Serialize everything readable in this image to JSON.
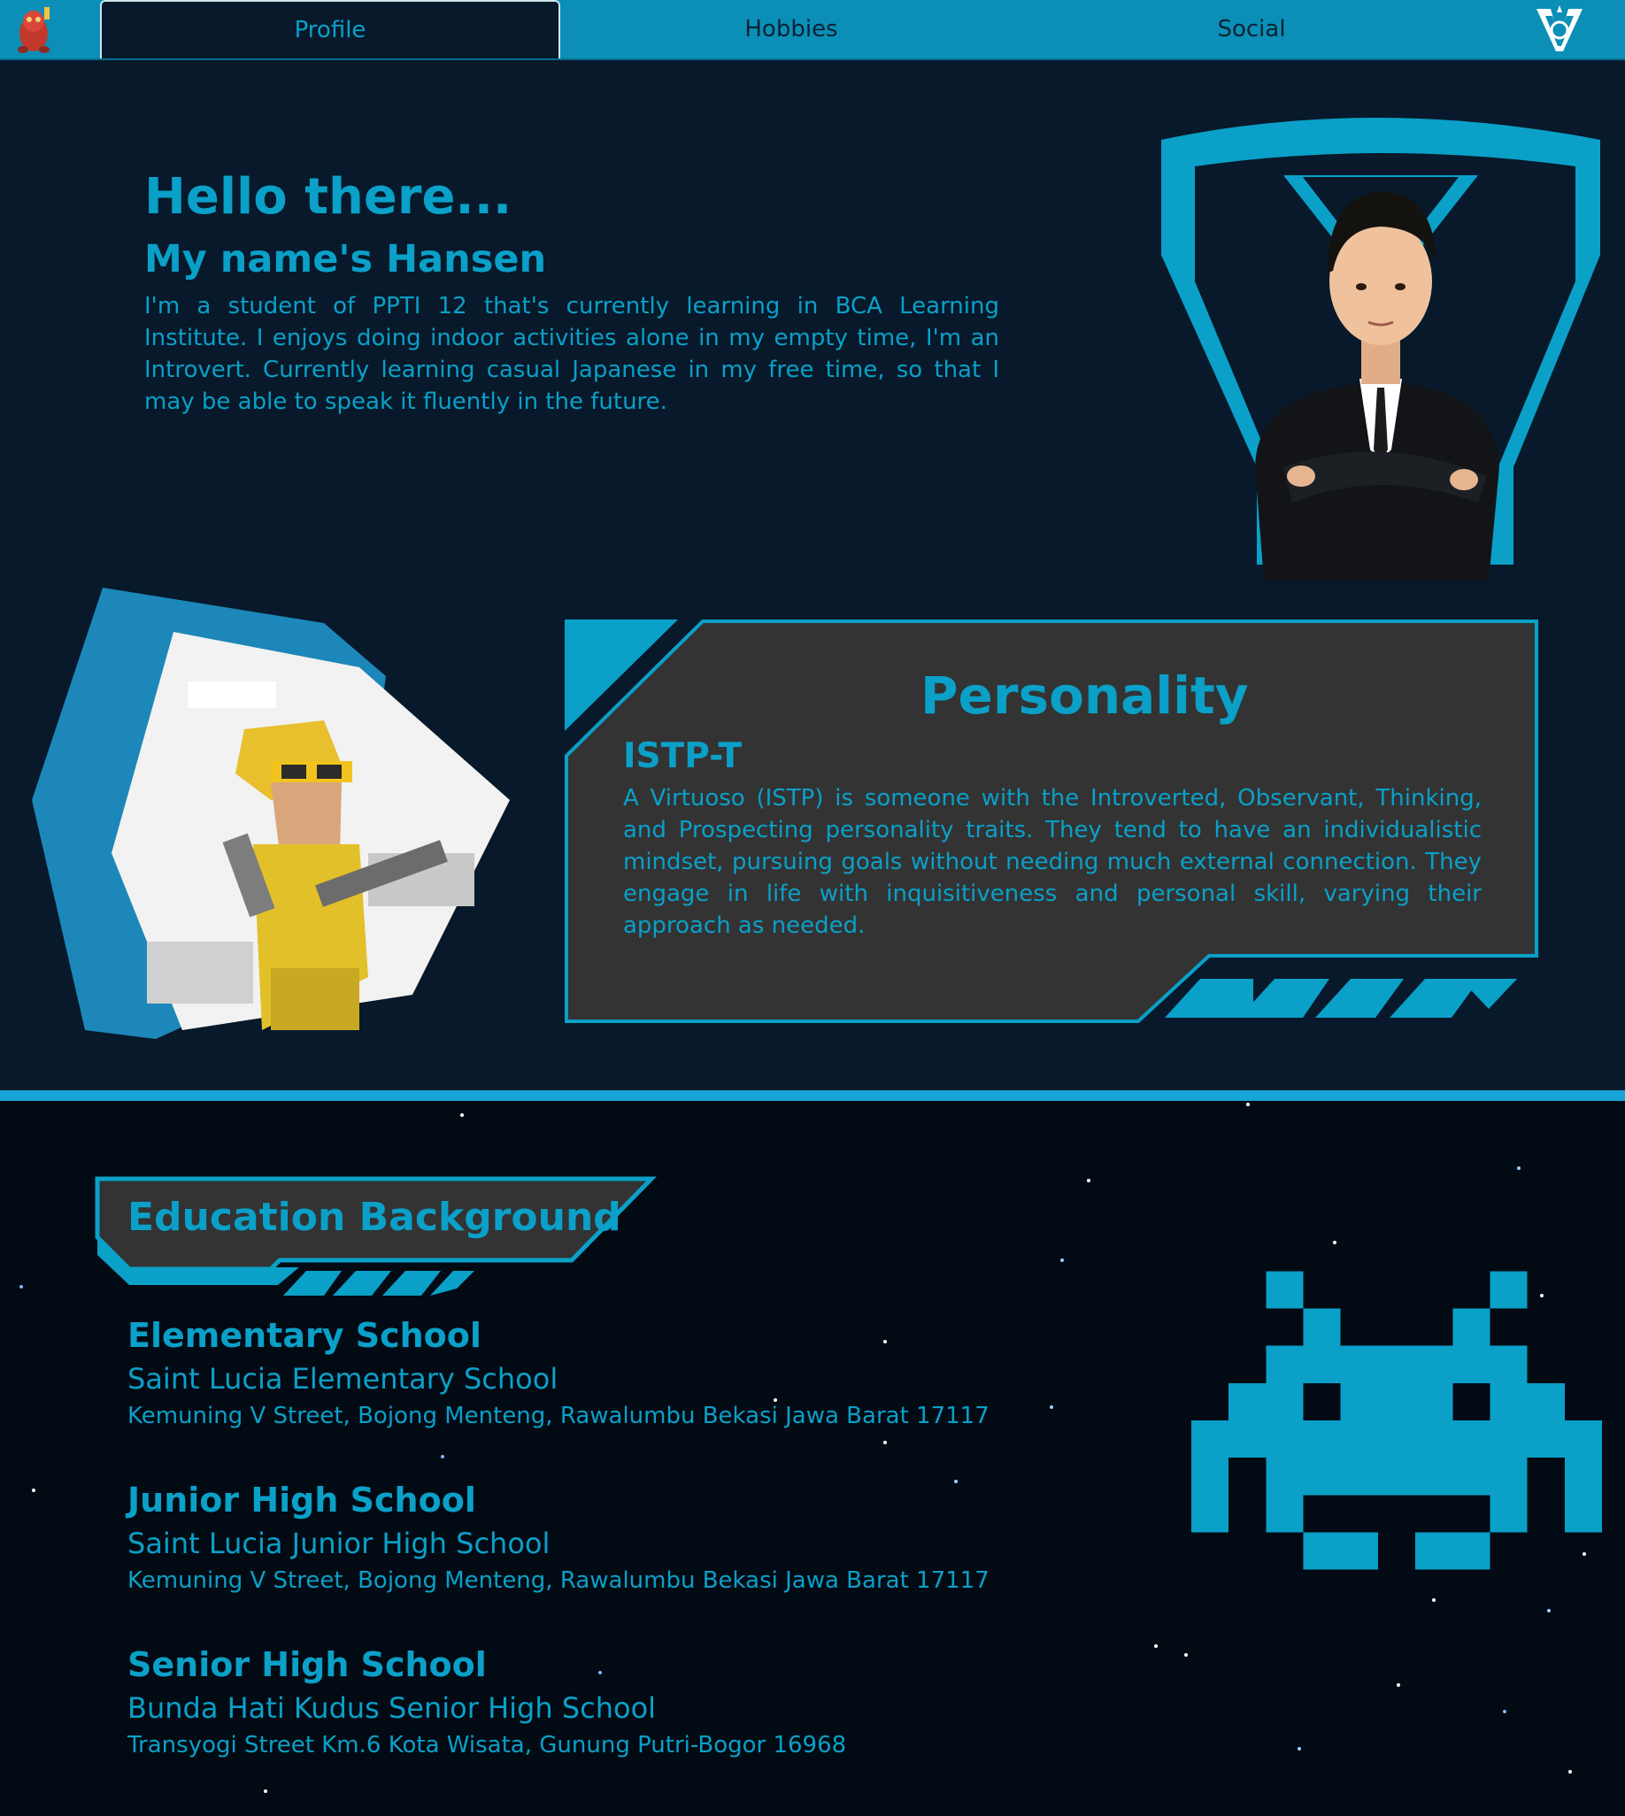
{
  "nav": {
    "tabs": [
      {
        "label": "Profile",
        "active": true
      },
      {
        "label": "Hobbies",
        "active": false
      },
      {
        "label": "Social",
        "active": false
      }
    ],
    "logo_icon": "mascot-icon",
    "brand_icon": "v-emblem-icon"
  },
  "intro": {
    "greeting": "Hello there...",
    "name_line": "My name's Hansen",
    "bio": "I'm a student of PPTI 12 that's currently learning in BCA Learning Institute. I enjoys doing indoor activities alone in my empty time, I'm an Introvert. Currently learning casual Japanese in my free time, so that I may be able to speak it fluently in the future."
  },
  "personality": {
    "title": "Personality",
    "type": "ISTP-T",
    "description": "A Virtuoso (ISTP) is someone with the Introverted, Observant, Thinking, and Prospecting personality traits. They tend to have an individualistic mindset, pursuing goals without needing much external connection. They engage in life with inquisitiveness and personal skill, varying their approach as needed."
  },
  "education": {
    "title": "Education Background",
    "entries": [
      {
        "level": "Elementary School",
        "school": "Saint Lucia Elementary School",
        "address": "Kemuning V Street, Bojong Menteng, Rawalumbu Bekasi Jawa Barat 17117"
      },
      {
        "level": "Junior High School",
        "school": "Saint Lucia Junior High School",
        "address": "Kemuning V Street, Bojong Menteng, Rawalumbu Bekasi Jawa Barat 17117"
      },
      {
        "level": "Senior High School",
        "school": "Bunda Hati Kudus Senior High School",
        "address": "Transyogi Street Km.6 Kota Wisata, Gunung Putri-Bogor 16968"
      }
    ]
  },
  "colors": {
    "accent": "#0aa0c8",
    "nav_bg": "#0b8fb7",
    "page_bg": "#07192a",
    "panel_bg": "#333333"
  }
}
